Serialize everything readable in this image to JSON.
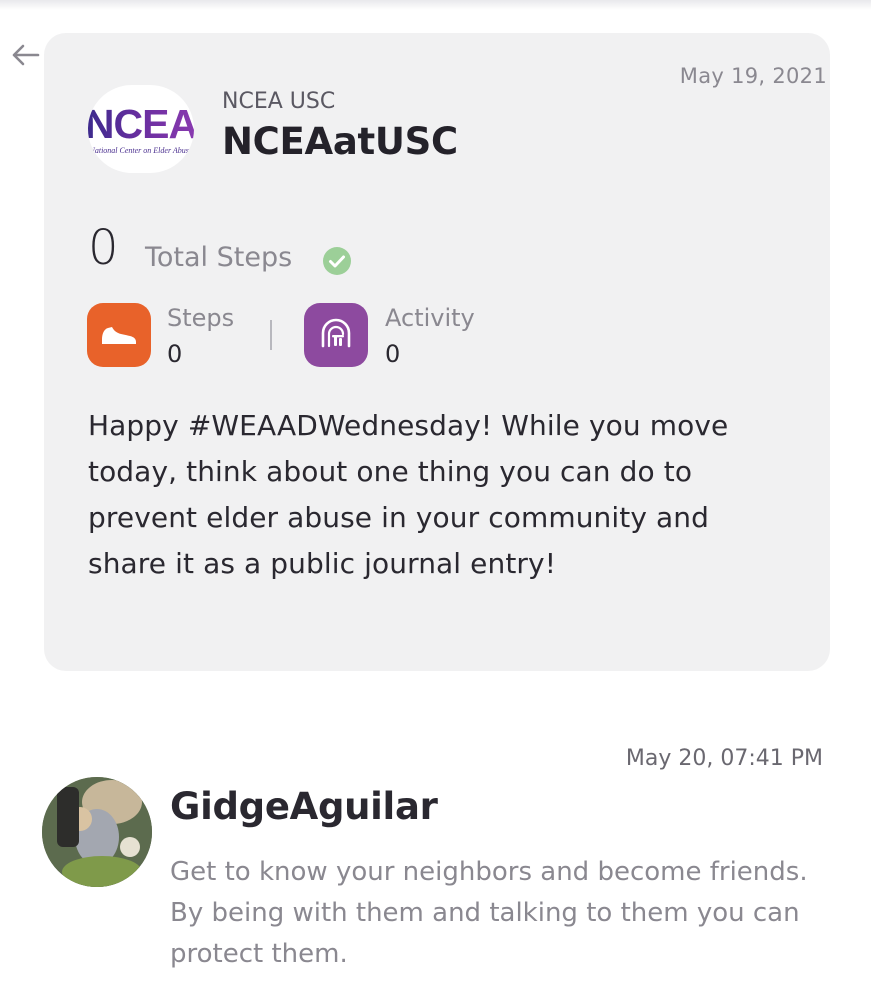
{
  "post": {
    "date": "May 19, 2021",
    "logo": {
      "word": "NCEA",
      "tagline": "National Center on Elder Abuse"
    },
    "org_subtitle": "NCEA USC",
    "org_name": "NCEAatUSC",
    "total_steps": {
      "value": "0",
      "label": "Total Steps"
    },
    "stats": {
      "steps": {
        "label": "Steps",
        "value": "0"
      },
      "activity": {
        "label": "Activity",
        "value": "0"
      }
    },
    "message": "Happy #WEAADWednesday! While you move today, think about one thing you can do to prevent elder abuse in your community and share it as a public journal entry!"
  },
  "comment": {
    "date": "May 20, 07:41 PM",
    "username": "GidgeAguilar",
    "text": "Get to know your neighbors and become friends. By being with them and talking to them you can protect them."
  },
  "icons": {
    "back": "arrow-left-icon",
    "verified": "check-circle-icon",
    "steps": "shoe-icon",
    "activity": "activity-icon"
  },
  "colors": {
    "card_bg": "#f1f1f2",
    "steps_accent": "#e8622a",
    "activity_accent": "#8d4a9f",
    "verified_green": "#9ccf98"
  }
}
